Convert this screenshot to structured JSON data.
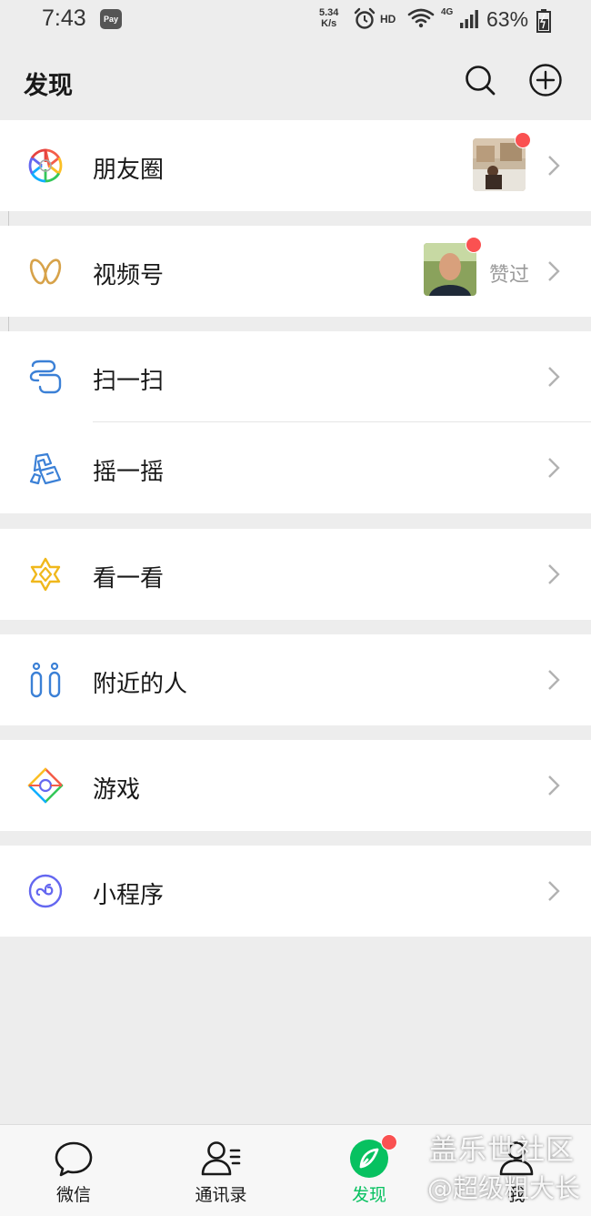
{
  "status_bar": {
    "time": "7:43",
    "pay_badge": "Pay",
    "speed_value": "5.34",
    "speed_unit": "K/s",
    "hd": "HD",
    "network": "4G",
    "battery_percent": "63%",
    "icons": [
      "alarm-icon",
      "wifi-icon",
      "signal-icon",
      "battery-icon"
    ]
  },
  "header": {
    "title": "发现",
    "icons": [
      "search-icon",
      "add-icon"
    ]
  },
  "list": {
    "moments": {
      "label": "朋友圈",
      "icon": "moments-icon",
      "has_new": true
    },
    "channels": {
      "label": "视频号",
      "icon": "channels-icon",
      "status": "赞过",
      "has_new": true
    },
    "scan": {
      "label": "扫一扫",
      "icon": "scan-icon"
    },
    "shake": {
      "label": "摇一摇",
      "icon": "shake-icon"
    },
    "top_stories": {
      "label": "看一看",
      "icon": "top-stories-icon"
    },
    "nearby": {
      "label": "附近的人",
      "icon": "people-nearby-icon"
    },
    "games": {
      "label": "游戏",
      "icon": "games-icon"
    },
    "mini_programs": {
      "label": "小程序",
      "icon": "mini-programs-icon"
    }
  },
  "tab_bar": {
    "tabs": [
      {
        "label": "微信",
        "icon": "chat-icon",
        "active": false
      },
      {
        "label": "通讯录",
        "icon": "contacts-icon",
        "active": false
      },
      {
        "label": "发现",
        "icon": "discover-icon",
        "active": true,
        "has_new": true
      },
      {
        "label": "我",
        "icon": "me-icon",
        "active": false
      }
    ]
  },
  "watermark": {
    "line1": "盖乐世社区",
    "line2": "@超级粗大长"
  },
  "colors": {
    "accent_green": "#07c160",
    "badge_red": "#fa5151",
    "background": "#ededed"
  }
}
